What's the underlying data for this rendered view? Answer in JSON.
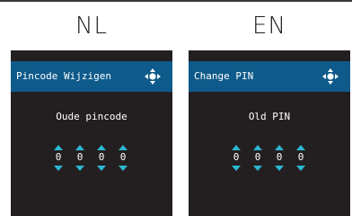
{
  "accent_color": "#0e5a8a",
  "arrow_color": "#2bb7d3",
  "screens": [
    {
      "language": "NL",
      "header_title": "Pincode Wijzigen",
      "header_icon": "directional-pad-icon",
      "prompt": "Oude pincode",
      "digits": [
        "0",
        "0",
        "0",
        "0"
      ]
    },
    {
      "language": "EN",
      "header_title": "Change PIN",
      "header_icon": "directional-pad-icon",
      "prompt": "Old PIN",
      "digits": [
        "0",
        "0",
        "0",
        "0"
      ]
    }
  ]
}
